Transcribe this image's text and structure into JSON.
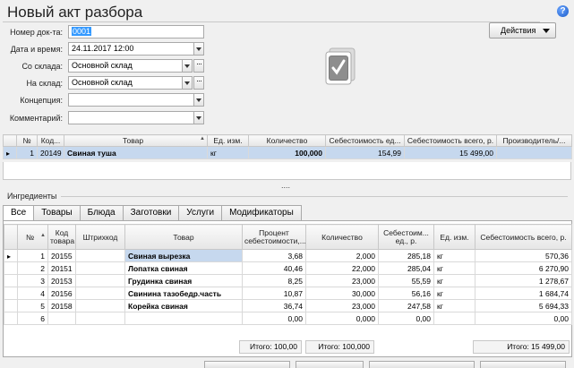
{
  "title": "Новый акт разбора",
  "form": {
    "doc_number_label": "Номер док-та:",
    "doc_number_value": "0001",
    "datetime_label": "Дата и время:",
    "datetime_value": "24.11.2017 12:00",
    "from_store_label": "Со склада:",
    "from_store_value": "Основной склад",
    "to_store_label": "На склад:",
    "to_store_value": "Основной склад",
    "concept_label": "Концепция:",
    "concept_value": "",
    "comment_label": "Комментарий:",
    "comment_value": ""
  },
  "actions_label": "Действия",
  "main_table": {
    "headers": [
      "№",
      "Код...",
      "Товар",
      "Ед. изм.",
      "Количество",
      "Себестоимость ед...",
      "Себестоимость всего, р.",
      "Производитель/..."
    ],
    "rows": [
      [
        "1",
        "20149",
        "Свиная туша",
        "кг",
        "100,000",
        "154,99",
        "15 499,00",
        ""
      ]
    ]
  },
  "splitter": "....",
  "ingredients_label": "Ингредиенты",
  "tabs": [
    "Все",
    "Товары",
    "Блюда",
    "Заготовки",
    "Услуги",
    "Модификаторы"
  ],
  "ingr_table": {
    "headers": [
      "№",
      "Код товара",
      "Штрихкод",
      "Товар",
      "Процент себестоимости,...",
      "Количество",
      "Себестоим... ед., р.",
      "Ед. изм.",
      "Себестоимость всего, р."
    ],
    "rows": [
      [
        "1",
        "20155",
        "",
        "Свиная вырезка",
        "3,68",
        "2,000",
        "285,18",
        "кг",
        "570,36"
      ],
      [
        "2",
        "20151",
        "",
        "Лопатка свиная",
        "40,46",
        "22,000",
        "285,04",
        "кг",
        "6 270,90"
      ],
      [
        "3",
        "20153",
        "",
        "Грудинка свиная",
        "8,25",
        "23,000",
        "55,59",
        "кг",
        "1 278,67"
      ],
      [
        "4",
        "20156",
        "",
        "Свинина тазобедр.часть",
        "10,87",
        "30,000",
        "56,16",
        "кг",
        "1 684,74"
      ],
      [
        "5",
        "20158",
        "",
        "Корейка свиная",
        "36,74",
        "23,000",
        "247,58",
        "кг",
        "5 694,33"
      ],
      [
        "6",
        "",
        "",
        "",
        "0,00",
        "0,000",
        "0,00",
        "",
        "0,00"
      ]
    ]
  },
  "totals": {
    "percent": "Итого: 100,00",
    "quantity": "Итого: 100,000",
    "cost": "Итого: 15 499,00"
  },
  "colors": {
    "selection": "#c6d8ee",
    "highlight": "#3399ff"
  }
}
